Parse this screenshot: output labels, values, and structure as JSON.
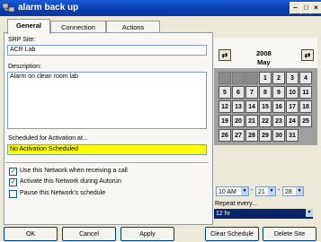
{
  "window": {
    "title": "alarm back up"
  },
  "tabs": [
    {
      "label": "General"
    },
    {
      "label": "Connection"
    },
    {
      "label": "Actions"
    }
  ],
  "general": {
    "srp_site_label": "SRP Site:",
    "srp_site_value": "ACR Lab",
    "description_label": "Description:",
    "description_value": "Alarm on clean room lab",
    "scheduled_label": "Scheduled for Activation at...",
    "scheduled_value": "No Activation Scheduled",
    "checkboxes": [
      {
        "label": "Use this Network when receiving a call",
        "checked": true
      },
      {
        "label": "Activate this Network during Autorun",
        "checked": true
      },
      {
        "label": "Pause this Network's schedule",
        "checked": false
      }
    ]
  },
  "calendar": {
    "year": "2008",
    "month": "May",
    "prev_icon": "left-arrow-icon",
    "next_icon": "right-arrow-icon",
    "leading_blanks": 3,
    "days": [
      "1",
      "2",
      "3",
      "4",
      "5",
      "6",
      "7",
      "8",
      "9",
      "10",
      "11",
      "12",
      "13",
      "14",
      "15",
      "16",
      "17",
      "18",
      "19",
      "20",
      "21",
      "22",
      "23",
      "24",
      "25",
      "26",
      "27",
      "28",
      "29",
      "30",
      "31"
    ]
  },
  "time": {
    "hour": "10 AM",
    "minute": "21",
    "second": "28"
  },
  "repeat": {
    "label": "Repeat every...",
    "value": "12 hr"
  },
  "buttons": {
    "ok": "OK",
    "cancel": "Cancel",
    "apply": "Apply",
    "clear_schedule": "Clear Schedule",
    "delete_site": "Delete Site"
  }
}
